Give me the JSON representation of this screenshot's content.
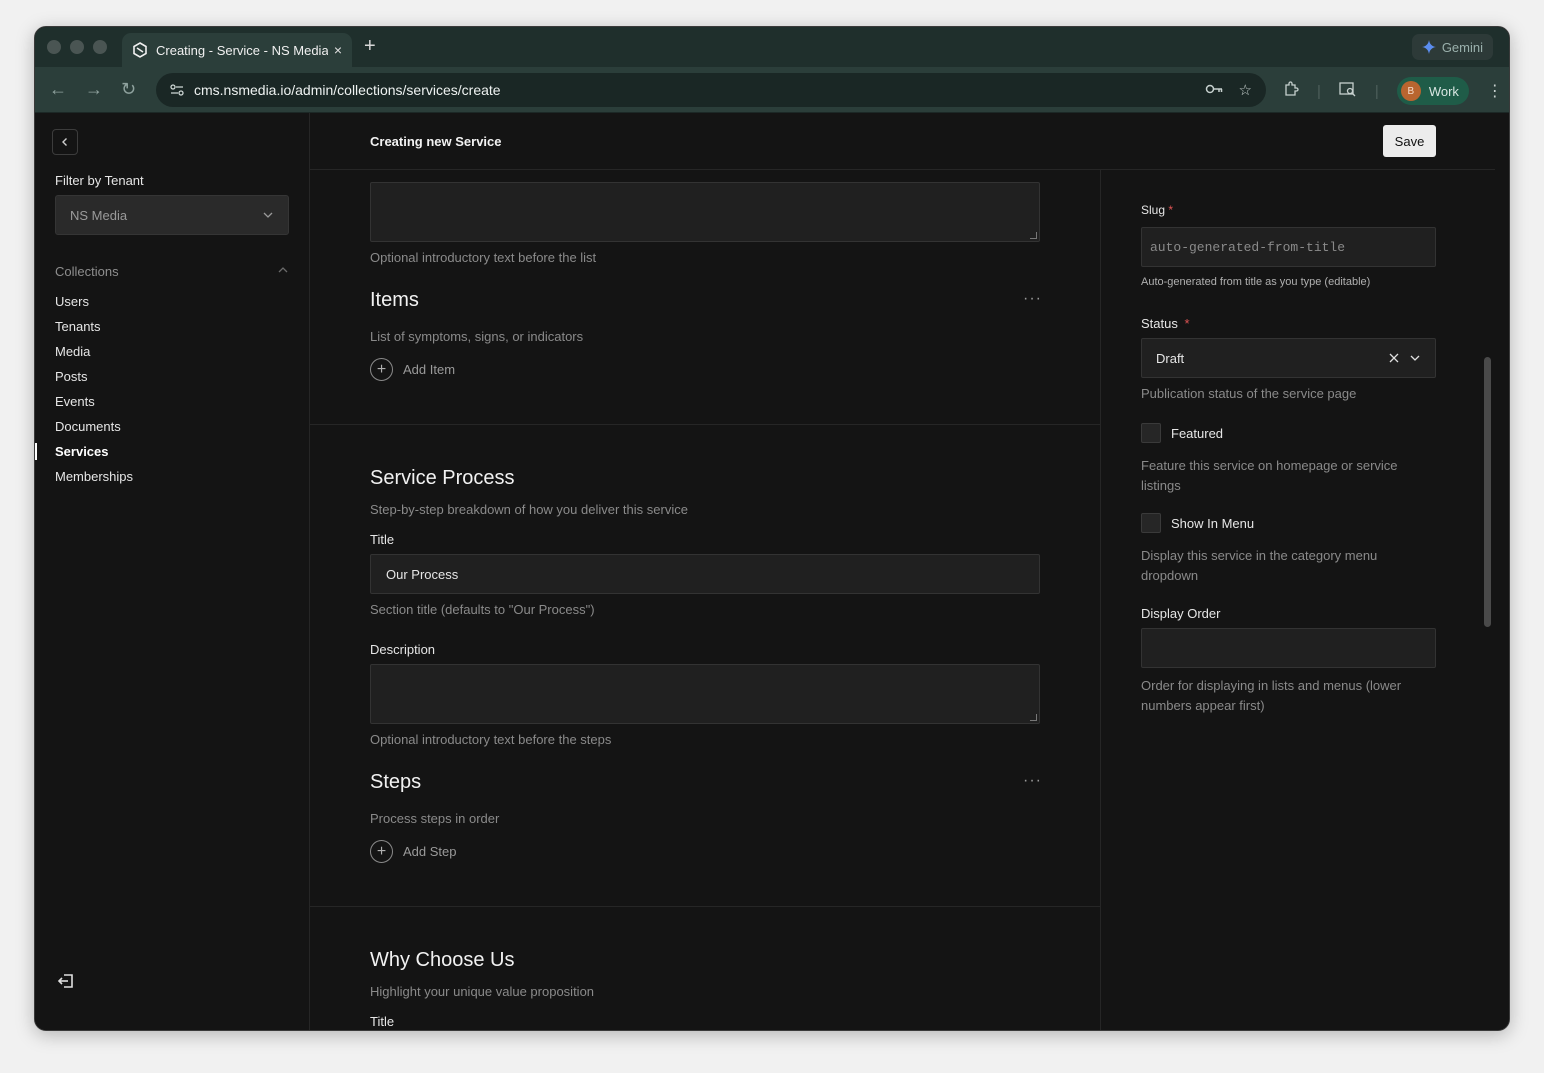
{
  "browser": {
    "tab_title": "Creating - Service - NS Media",
    "tab_close": "×",
    "new_tab": "+",
    "gemini_label": "Gemini",
    "url": "cms.nsmedia.io/admin/collections/services/create",
    "profile_initial": "B",
    "profile_label": "Work"
  },
  "sidebar": {
    "filter_label": "Filter by Tenant",
    "tenant_value": "NS Media",
    "collections_label": "Collections",
    "items": [
      {
        "label": "Users"
      },
      {
        "label": "Tenants"
      },
      {
        "label": "Media"
      },
      {
        "label": "Posts"
      },
      {
        "label": "Events"
      },
      {
        "label": "Documents"
      },
      {
        "label": "Services",
        "active": true
      },
      {
        "label": "Memberships"
      }
    ]
  },
  "header": {
    "title": "Creating new Service",
    "save_label": "Save"
  },
  "content": {
    "items_intro_help": "Optional introductory text before the list",
    "items": {
      "title": "Items",
      "help": "List of symptoms, signs, or indicators",
      "add_label": "Add Item"
    },
    "service_process": {
      "title": "Service Process",
      "subtitle": "Step-by-step breakdown of how you deliver this service",
      "title_label": "Title",
      "title_value": "Our Process",
      "title_help": "Section title (defaults to \"Our Process\")",
      "description_label": "Description",
      "description_help": "Optional introductory text before the steps"
    },
    "steps": {
      "title": "Steps",
      "help": "Process steps in order",
      "add_label": "Add Step"
    },
    "why_choose_us": {
      "title": "Why Choose Us",
      "subtitle": "Highlight your unique value proposition",
      "title_label": "Title"
    }
  },
  "aside": {
    "slug_label": "Slug",
    "slug_placeholder": "auto-generated-from-title",
    "slug_help": "Auto-generated from title as you type (editable)",
    "status_label": "Status",
    "status_value": "Draft",
    "status_help": "Publication status of the service page",
    "featured_label": "Featured",
    "featured_help": "Feature this service on homepage or service listings",
    "show_in_menu_label": "Show In Menu",
    "show_in_menu_help": "Display this service in the category menu dropdown",
    "display_order_label": "Display Order",
    "display_order_help": "Order for displaying in lists and menus (lower numbers appear first)",
    "required_mark": "*"
  },
  "icons": [
    "back-arrow-icon",
    "forward-arrow-icon",
    "reload-icon",
    "site-settings-icon",
    "password-key-icon",
    "bookmark-star-icon",
    "extensions-icon",
    "tab-search-icon",
    "more-vert-icon",
    "chevron-left-icon",
    "chevron-down-icon",
    "chevron-up-icon",
    "clear-x-icon",
    "plus-circle-icon",
    "logout-icon",
    "more-horiz-icon"
  ],
  "colors": {
    "accent": "#ececec",
    "required": "#e05555",
    "browser_frame": "#2b3e3a"
  }
}
